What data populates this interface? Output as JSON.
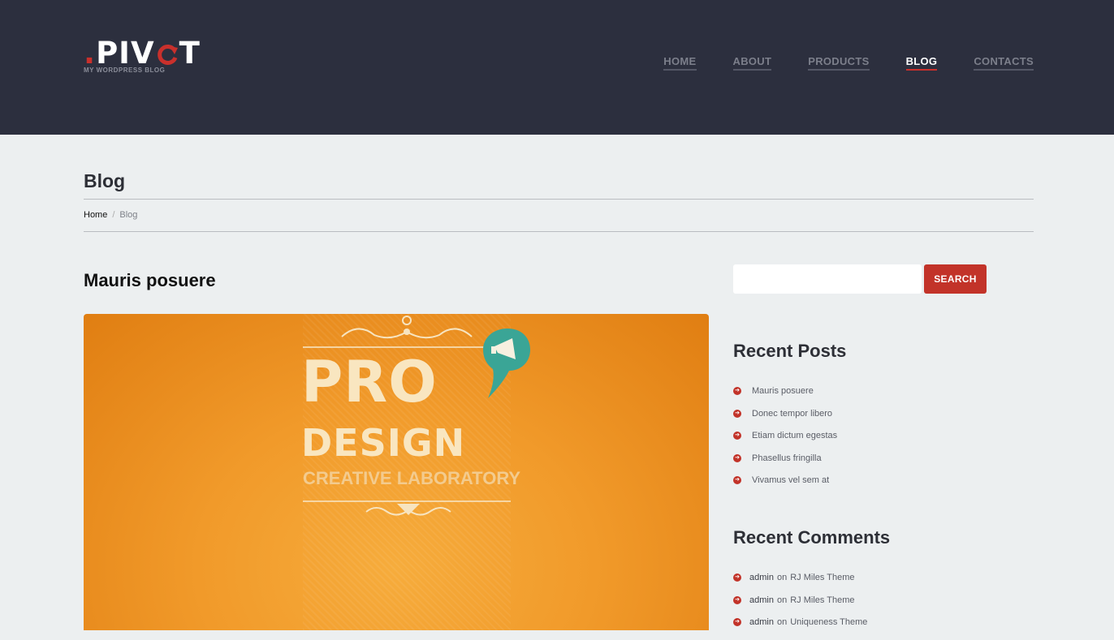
{
  "logo": {
    "text_start": ".PIV",
    "text_end": "T",
    "dot": ".",
    "tagline": "MY WORDPRESS BLOG"
  },
  "nav": {
    "items": [
      "HOME",
      "ABOUT",
      "PRODUCTS",
      "BLOG",
      "CONTACTS"
    ],
    "active": "BLOG"
  },
  "page": {
    "title": "Blog"
  },
  "breadcrumb": {
    "home": "Home",
    "separator": "/",
    "current": "Blog"
  },
  "post": {
    "title": "Mauris posuere",
    "image_text": {
      "line1": "PRO",
      "line2": "DESIGN",
      "line3": "CREATIVE LABORATORY"
    }
  },
  "search": {
    "button_label": "SEARCH",
    "placeholder": ""
  },
  "recent_posts": {
    "title": "Recent Posts",
    "items": [
      "Mauris posuere",
      "Donec tempor libero",
      "Etiam dictum egestas",
      "Phasellus fringilla",
      "Vivamus vel sem at"
    ]
  },
  "recent_comments": {
    "title": "Recent Comments",
    "items": [
      {
        "author": "admin",
        "on": "on",
        "post": "RJ Miles Theme"
      },
      {
        "author": "admin",
        "on": "on",
        "post": "RJ Miles Theme"
      },
      {
        "author": "admin",
        "on": "on",
        "post": "Uniqueness Theme"
      }
    ]
  },
  "colors": {
    "header_bg": "#2c2f3e",
    "accent": "#c23329",
    "page_bg": "#eceff0",
    "image_orange": "#f19a2a"
  }
}
